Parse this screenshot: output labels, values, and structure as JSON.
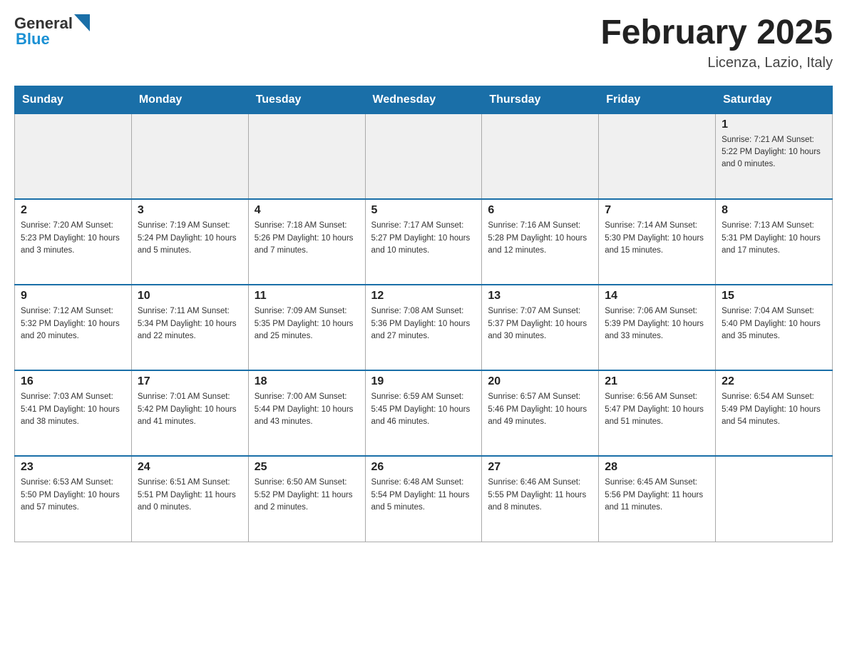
{
  "header": {
    "logo_general": "General",
    "logo_blue": "Blue",
    "title": "February 2025",
    "location": "Licenza, Lazio, Italy"
  },
  "days_of_week": [
    "Sunday",
    "Monday",
    "Tuesday",
    "Wednesday",
    "Thursday",
    "Friday",
    "Saturday"
  ],
  "weeks": [
    [
      {
        "day": "",
        "info": ""
      },
      {
        "day": "",
        "info": ""
      },
      {
        "day": "",
        "info": ""
      },
      {
        "day": "",
        "info": ""
      },
      {
        "day": "",
        "info": ""
      },
      {
        "day": "",
        "info": ""
      },
      {
        "day": "1",
        "info": "Sunrise: 7:21 AM\nSunset: 5:22 PM\nDaylight: 10 hours and 0 minutes."
      }
    ],
    [
      {
        "day": "2",
        "info": "Sunrise: 7:20 AM\nSunset: 5:23 PM\nDaylight: 10 hours and 3 minutes."
      },
      {
        "day": "3",
        "info": "Sunrise: 7:19 AM\nSunset: 5:24 PM\nDaylight: 10 hours and 5 minutes."
      },
      {
        "day": "4",
        "info": "Sunrise: 7:18 AM\nSunset: 5:26 PM\nDaylight: 10 hours and 7 minutes."
      },
      {
        "day": "5",
        "info": "Sunrise: 7:17 AM\nSunset: 5:27 PM\nDaylight: 10 hours and 10 minutes."
      },
      {
        "day": "6",
        "info": "Sunrise: 7:16 AM\nSunset: 5:28 PM\nDaylight: 10 hours and 12 minutes."
      },
      {
        "day": "7",
        "info": "Sunrise: 7:14 AM\nSunset: 5:30 PM\nDaylight: 10 hours and 15 minutes."
      },
      {
        "day": "8",
        "info": "Sunrise: 7:13 AM\nSunset: 5:31 PM\nDaylight: 10 hours and 17 minutes."
      }
    ],
    [
      {
        "day": "9",
        "info": "Sunrise: 7:12 AM\nSunset: 5:32 PM\nDaylight: 10 hours and 20 minutes."
      },
      {
        "day": "10",
        "info": "Sunrise: 7:11 AM\nSunset: 5:34 PM\nDaylight: 10 hours and 22 minutes."
      },
      {
        "day": "11",
        "info": "Sunrise: 7:09 AM\nSunset: 5:35 PM\nDaylight: 10 hours and 25 minutes."
      },
      {
        "day": "12",
        "info": "Sunrise: 7:08 AM\nSunset: 5:36 PM\nDaylight: 10 hours and 27 minutes."
      },
      {
        "day": "13",
        "info": "Sunrise: 7:07 AM\nSunset: 5:37 PM\nDaylight: 10 hours and 30 minutes."
      },
      {
        "day": "14",
        "info": "Sunrise: 7:06 AM\nSunset: 5:39 PM\nDaylight: 10 hours and 33 minutes."
      },
      {
        "day": "15",
        "info": "Sunrise: 7:04 AM\nSunset: 5:40 PM\nDaylight: 10 hours and 35 minutes."
      }
    ],
    [
      {
        "day": "16",
        "info": "Sunrise: 7:03 AM\nSunset: 5:41 PM\nDaylight: 10 hours and 38 minutes."
      },
      {
        "day": "17",
        "info": "Sunrise: 7:01 AM\nSunset: 5:42 PM\nDaylight: 10 hours and 41 minutes."
      },
      {
        "day": "18",
        "info": "Sunrise: 7:00 AM\nSunset: 5:44 PM\nDaylight: 10 hours and 43 minutes."
      },
      {
        "day": "19",
        "info": "Sunrise: 6:59 AM\nSunset: 5:45 PM\nDaylight: 10 hours and 46 minutes."
      },
      {
        "day": "20",
        "info": "Sunrise: 6:57 AM\nSunset: 5:46 PM\nDaylight: 10 hours and 49 minutes."
      },
      {
        "day": "21",
        "info": "Sunrise: 6:56 AM\nSunset: 5:47 PM\nDaylight: 10 hours and 51 minutes."
      },
      {
        "day": "22",
        "info": "Sunrise: 6:54 AM\nSunset: 5:49 PM\nDaylight: 10 hours and 54 minutes."
      }
    ],
    [
      {
        "day": "23",
        "info": "Sunrise: 6:53 AM\nSunset: 5:50 PM\nDaylight: 10 hours and 57 minutes."
      },
      {
        "day": "24",
        "info": "Sunrise: 6:51 AM\nSunset: 5:51 PM\nDaylight: 11 hours and 0 minutes."
      },
      {
        "day": "25",
        "info": "Sunrise: 6:50 AM\nSunset: 5:52 PM\nDaylight: 11 hours and 2 minutes."
      },
      {
        "day": "26",
        "info": "Sunrise: 6:48 AM\nSunset: 5:54 PM\nDaylight: 11 hours and 5 minutes."
      },
      {
        "day": "27",
        "info": "Sunrise: 6:46 AM\nSunset: 5:55 PM\nDaylight: 11 hours and 8 minutes."
      },
      {
        "day": "28",
        "info": "Sunrise: 6:45 AM\nSunset: 5:56 PM\nDaylight: 11 hours and 11 minutes."
      },
      {
        "day": "",
        "info": ""
      }
    ]
  ]
}
